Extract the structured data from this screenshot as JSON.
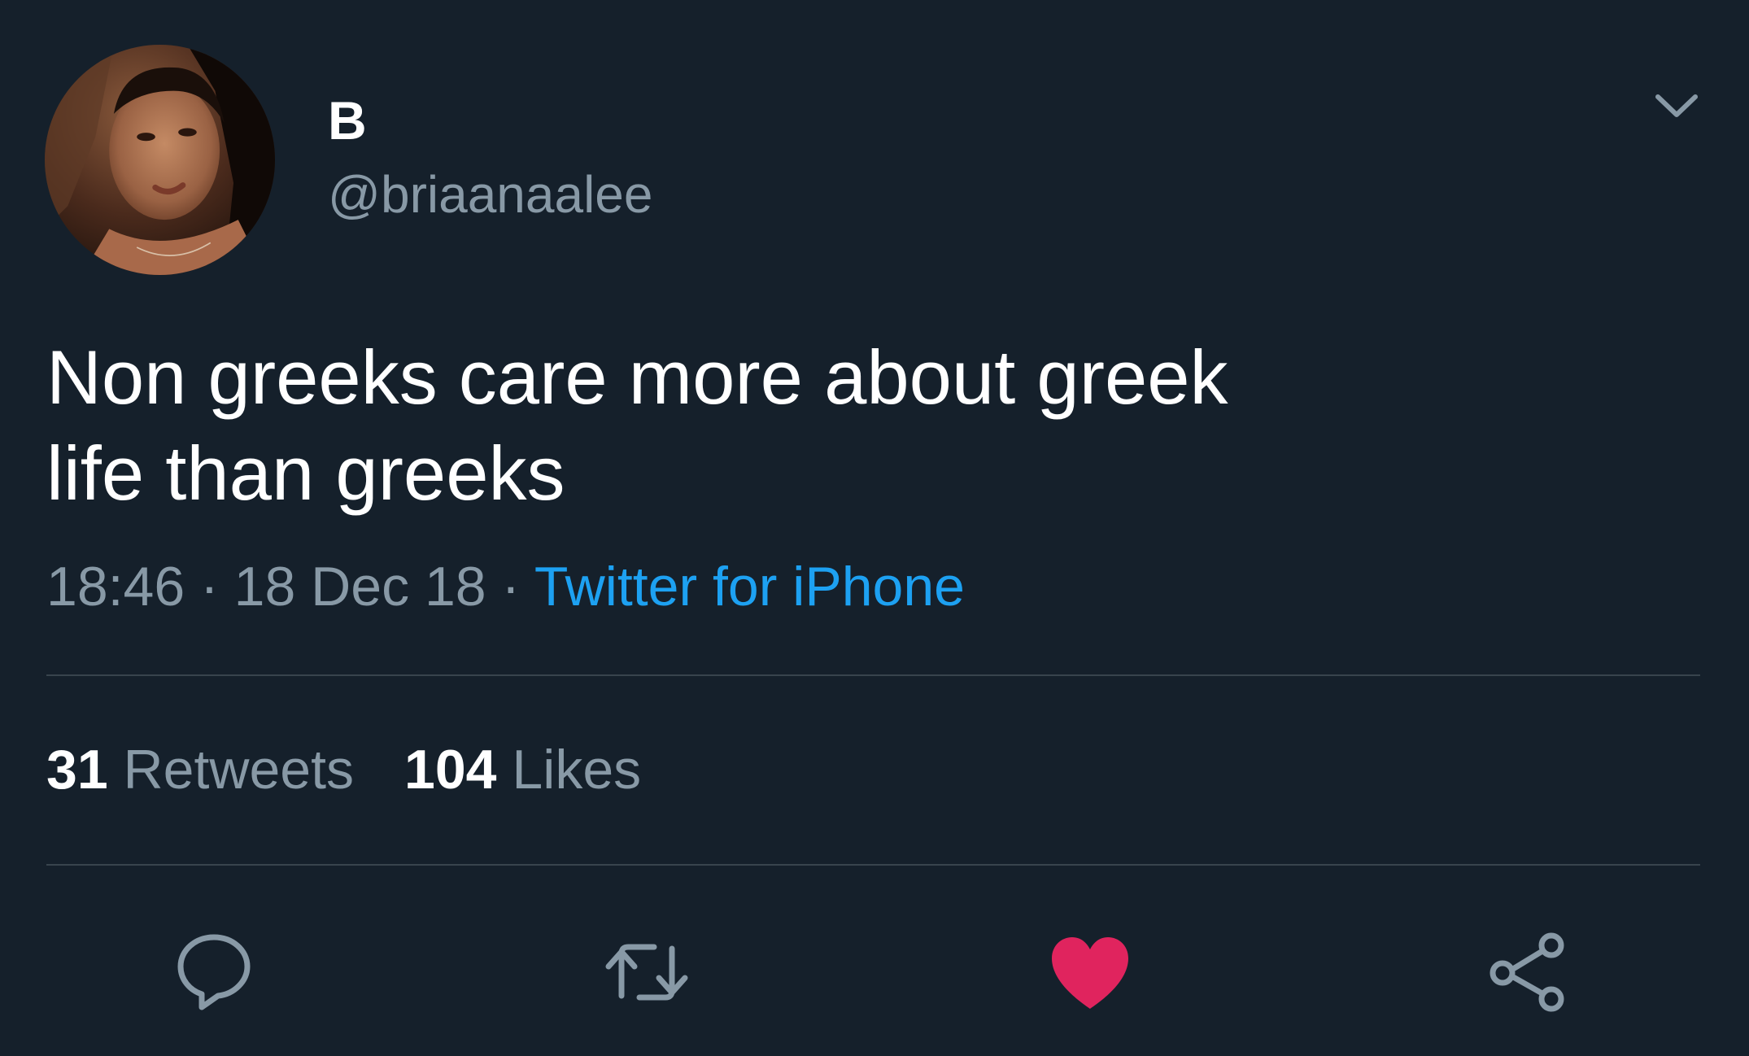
{
  "user": {
    "display_name": "B",
    "handle": "@briaanaalee"
  },
  "tweet": {
    "text": "Non greeks care more about greek\nlife than greeks",
    "time": "18:46",
    "date": "18 Dec 18",
    "source": "Twitter for iPhone",
    "separator": "·"
  },
  "stats": {
    "retweets_count": "31",
    "retweets_label": "Retweets",
    "likes_count": "104",
    "likes_label": "Likes"
  },
  "icons": {
    "reply": "reply-icon",
    "retweet": "retweet-icon",
    "like": "heart-icon",
    "share": "share-icon",
    "caret": "chevron-down-icon"
  },
  "colors": {
    "background": "#15202b",
    "muted_text": "#8899a6",
    "link": "#1da1f2",
    "like": "#e0245e",
    "divider": "#38444d"
  },
  "state": {
    "liked": true
  }
}
